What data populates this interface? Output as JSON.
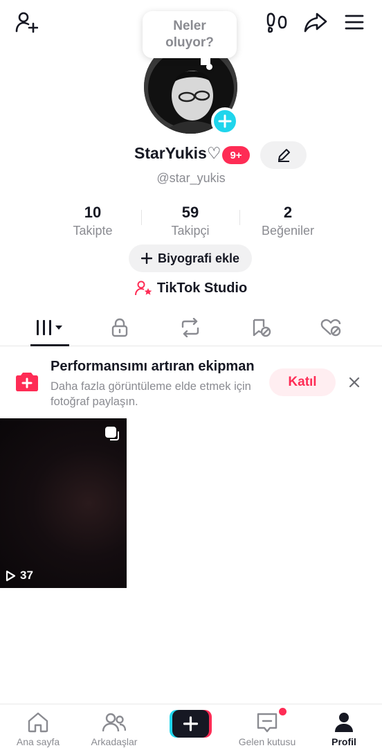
{
  "header": {
    "add_friend_icon": "person-add-icon",
    "footprints_icon": "footprints-icon",
    "share_icon": "share-icon",
    "menu_icon": "hamburger-menu-icon"
  },
  "profile": {
    "thought_bubble": "Neler oluyor?",
    "username": "StarYukis♡",
    "notification_badge": "9+",
    "handle": "@star_yukis",
    "stats": [
      {
        "value": "10",
        "label": "Takipte"
      },
      {
        "value": "59",
        "label": "Takipçi"
      },
      {
        "value": "2",
        "label": "Beğeniler"
      }
    ],
    "bio_button": "Biyografi ekle",
    "studio_link": "TikTok Studio"
  },
  "tabs": [
    {
      "icon": "videos-grid-icon",
      "active": true
    },
    {
      "icon": "lock-icon",
      "active": false
    },
    {
      "icon": "repost-icon",
      "active": false
    },
    {
      "icon": "hidden-favorites-icon",
      "active": false
    },
    {
      "icon": "hidden-liked-icon",
      "active": false
    }
  ],
  "promo": {
    "title": "Performansımı artıran ekipman",
    "subtitle": "Daha fazla görüntüleme elde etmek için fotoğraf paylaşın.",
    "join_button": "Katıl"
  },
  "videos": [
    {
      "views": "37"
    }
  ],
  "bottom_nav": [
    {
      "label": "Ana sayfa",
      "icon": "home-icon"
    },
    {
      "label": "Arkadaşlar",
      "icon": "friends-icon"
    },
    {
      "label": "",
      "icon": "create-plus-icon"
    },
    {
      "label": "Gelen kutusu",
      "icon": "inbox-icon"
    },
    {
      "label": "Profil",
      "icon": "profile-icon",
      "active": true
    }
  ],
  "colors": {
    "accent": "#fe2c55",
    "cyan": "#20d5ec",
    "text": "#161823",
    "muted": "#8a8b91"
  }
}
